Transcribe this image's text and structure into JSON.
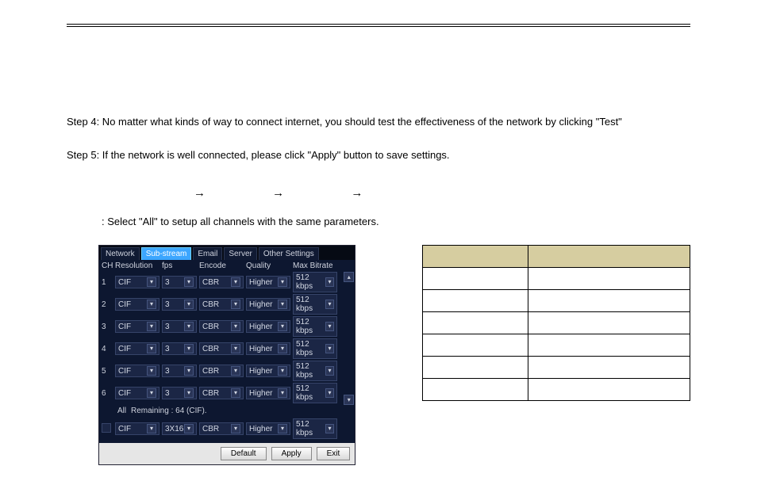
{
  "text": {
    "step4": "Step 4: No matter what kinds of way to connect internet, you should test the effectiveness of the network by clicking \"Test\"",
    "step5": "Step 5: If the network is well connected, please click \"Apply\" button to save settings.",
    "arrows": "→   →    →",
    "note": ": Select \"All\" to setup all channels with the same parameters."
  },
  "dvr": {
    "tabs": [
      "Network",
      "Sub-stream",
      "Email",
      "Server",
      "Other Settings"
    ],
    "active_tab": 1,
    "headers": {
      "ch": "CH",
      "res": "Resolution",
      "fps": "fps",
      "enc": "Encode",
      "qual": "Quality",
      "bit": "Max Bitrate"
    },
    "rows": [
      {
        "ch": "1",
        "res": "CIF",
        "fps": "3",
        "enc": "CBR",
        "qual": "Higher",
        "bit": "512 kbps"
      },
      {
        "ch": "2",
        "res": "CIF",
        "fps": "3",
        "enc": "CBR",
        "qual": "Higher",
        "bit": "512 kbps"
      },
      {
        "ch": "3",
        "res": "CIF",
        "fps": "3",
        "enc": "CBR",
        "qual": "Higher",
        "bit": "512 kbps"
      },
      {
        "ch": "4",
        "res": "CIF",
        "fps": "3",
        "enc": "CBR",
        "qual": "Higher",
        "bit": "512 kbps"
      },
      {
        "ch": "5",
        "res": "CIF",
        "fps": "3",
        "enc": "CBR",
        "qual": "Higher",
        "bit": "512 kbps"
      },
      {
        "ch": "6",
        "res": "CIF",
        "fps": "3",
        "enc": "CBR",
        "qual": "Higher",
        "bit": "512 kbps"
      }
    ],
    "all_label": "All",
    "remaining": "Remaining : 64 (CIF).",
    "all_row": {
      "res": "CIF",
      "fps": "3X16",
      "enc": "CBR",
      "qual": "Higher",
      "bit": "512 kbps"
    },
    "buttons": {
      "default": "Default",
      "apply": "Apply",
      "exit": "Exit"
    }
  },
  "param_table": {
    "head": [
      "",
      ""
    ],
    "rows": [
      [
        "",
        ""
      ],
      [
        "",
        ""
      ],
      [
        "",
        ""
      ],
      [
        "",
        ""
      ],
      [
        "",
        ""
      ],
      [
        "",
        ""
      ]
    ]
  }
}
